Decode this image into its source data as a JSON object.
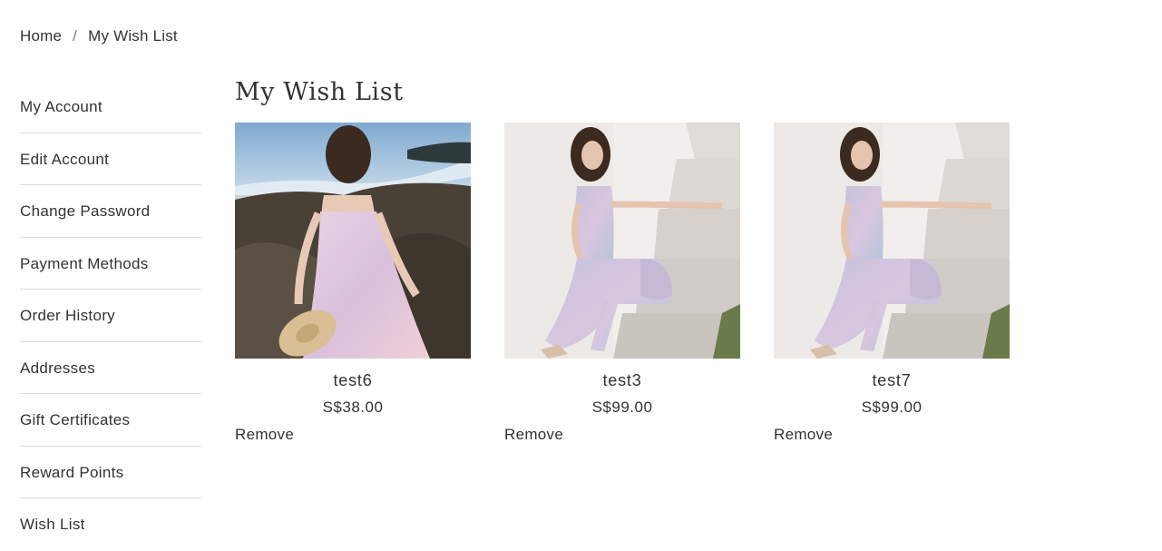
{
  "breadcrumb": {
    "home": "Home",
    "separator": "/",
    "current": "My Wish List"
  },
  "sidebar": {
    "items": [
      {
        "label": "My Account"
      },
      {
        "label": "Edit Account"
      },
      {
        "label": "Change Password"
      },
      {
        "label": "Payment Methods"
      },
      {
        "label": "Order History"
      },
      {
        "label": "Addresses"
      },
      {
        "label": "Gift Certificates"
      },
      {
        "label": "Reward Points"
      },
      {
        "label": "Wish List"
      }
    ]
  },
  "main": {
    "title": "My Wish List",
    "products": [
      {
        "name": "test6",
        "price": "S$38.00",
        "remove_label": "Remove"
      },
      {
        "name": "test3",
        "price": "S$99.00",
        "remove_label": "Remove"
      },
      {
        "name": "test7",
        "price": "S$99.00",
        "remove_label": "Remove"
      }
    ]
  }
}
